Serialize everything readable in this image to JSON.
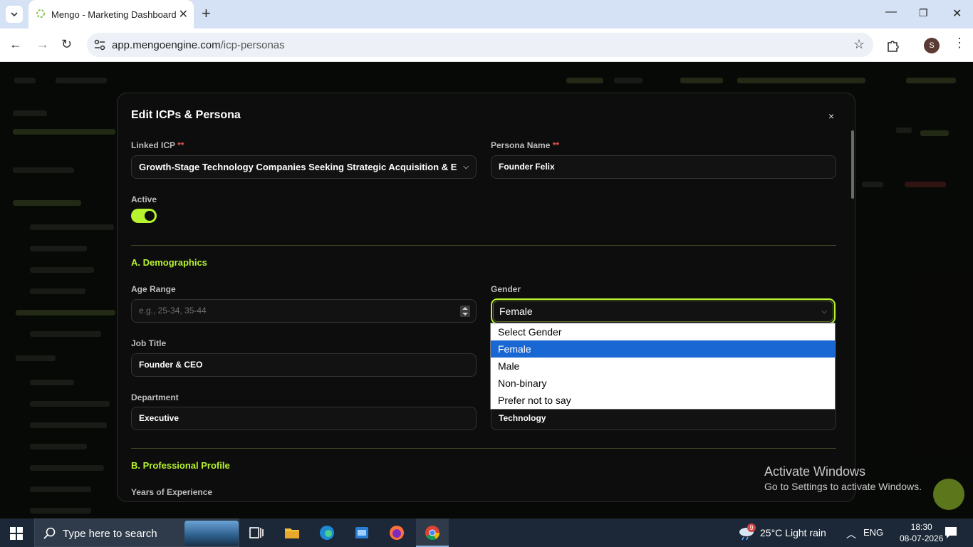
{
  "browser": {
    "tab_title": "Mengo - Marketing Dashboard",
    "url_host": "app.mengoengine.com",
    "url_path": "/icp-personas",
    "profile_initial": "S"
  },
  "modal": {
    "title": "Edit ICPs & Persona",
    "close_label": "×",
    "linked_icp_label": "Linked ICP",
    "linked_icp_required": "**",
    "linked_icp_value": "Growth-Stage Technology Companies Seeking Strategic Acquisition & E",
    "persona_name_label": "Persona Name",
    "persona_name_required": "**",
    "persona_name_value": "Founder Felix",
    "active_label": "Active",
    "active": true,
    "section_a": "A. Demographics",
    "age_range_label": "Age Range",
    "age_range_placeholder": "e.g., 25-34, 35-44",
    "gender_label": "Gender",
    "gender_value": "Female",
    "job_title_label": "Job Title",
    "job_title_value": "Founder & CEO",
    "department_label": "Department",
    "department_value": "Executive",
    "industry_value": "Technology",
    "section_b": "B. Professional Profile",
    "years_experience_label": "Years of Experience"
  },
  "gender_dropdown": {
    "options": [
      "Select Gender",
      "Female",
      "Male",
      "Non-binary",
      "Prefer not to say"
    ],
    "selected": "Female"
  },
  "watermark": {
    "line1": "Activate Windows",
    "line2": "Go to Settings to activate Windows."
  },
  "taskbar": {
    "search_placeholder": "Type here to search",
    "weather_badge": "9",
    "weather": "25°C  Light rain",
    "language": "ENG",
    "time": "18:30",
    "date": "08-07-2026"
  },
  "colors": {
    "accent": "#b8f32f",
    "modal_bg": "#0d0d0d",
    "selected_option": "#1967d2"
  }
}
